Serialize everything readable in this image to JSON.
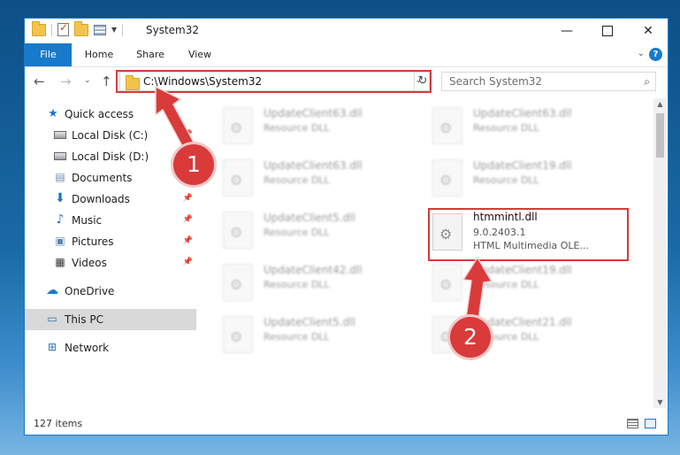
{
  "window": {
    "title": "System32"
  },
  "ribbon": {
    "tabs": [
      "File",
      "Home",
      "Share",
      "View"
    ]
  },
  "address": {
    "path": "C:\\Windows\\System32"
  },
  "search": {
    "placeholder": "Search System32"
  },
  "sidebar": {
    "items": [
      {
        "label": "Quick access",
        "icon": "star-icon",
        "pinned": false
      },
      {
        "label": "Local Disk (C:)",
        "icon": "drive-icon",
        "pinned": true
      },
      {
        "label": "Local Disk (D:)",
        "icon": "drive-icon",
        "pinned": false
      },
      {
        "label": "Documents",
        "icon": "documents-icon",
        "pinned": true
      },
      {
        "label": "Downloads",
        "icon": "download-icon",
        "pinned": true
      },
      {
        "label": "Music",
        "icon": "music-icon",
        "pinned": true
      },
      {
        "label": "Pictures",
        "icon": "pictures-icon",
        "pinned": true
      },
      {
        "label": "Videos",
        "icon": "videos-icon",
        "pinned": true
      },
      {
        "label": "OneDrive",
        "icon": "cloud-icon",
        "pinned": false
      },
      {
        "label": "This PC",
        "icon": "pc-icon",
        "pinned": false,
        "selected": true
      },
      {
        "label": "Network",
        "icon": "network-icon",
        "pinned": false
      }
    ]
  },
  "files": {
    "left_column": [
      {
        "name": "UpdateClient63.dll",
        "sub": "Resource DLL"
      },
      {
        "name": "UpdateClient63.dll",
        "sub": "Resource DLL"
      },
      {
        "name": "UpdateClient5.dll",
        "sub": "Resource DLL"
      },
      {
        "name": "UpdateClient42.dll",
        "sub": "Resource DLL"
      },
      {
        "name": "UpdateClient5.dll",
        "sub": "Resource DLL"
      }
    ],
    "right_column": [
      {
        "name": "UpdateClient63.dll",
        "sub": "Resource DLL"
      },
      {
        "name": "UpdateClient19.dll",
        "sub": "Resource DLL"
      },
      {
        "name": "UpdateClient19.dll",
        "sub": "Resource DLL"
      },
      {
        "name": "UpdateClient21.dll",
        "sub": "Resource DLL"
      }
    ],
    "highlighted": {
      "name": "htmmintl.dll",
      "version": "9.0.2403.1",
      "description": "HTML Multimedia OLE..."
    }
  },
  "status": {
    "item_count": "127 items"
  },
  "annotations": {
    "step1": "1",
    "step2": "2"
  },
  "colors": {
    "accent": "#1979ca",
    "highlight": "#d63a3a"
  }
}
